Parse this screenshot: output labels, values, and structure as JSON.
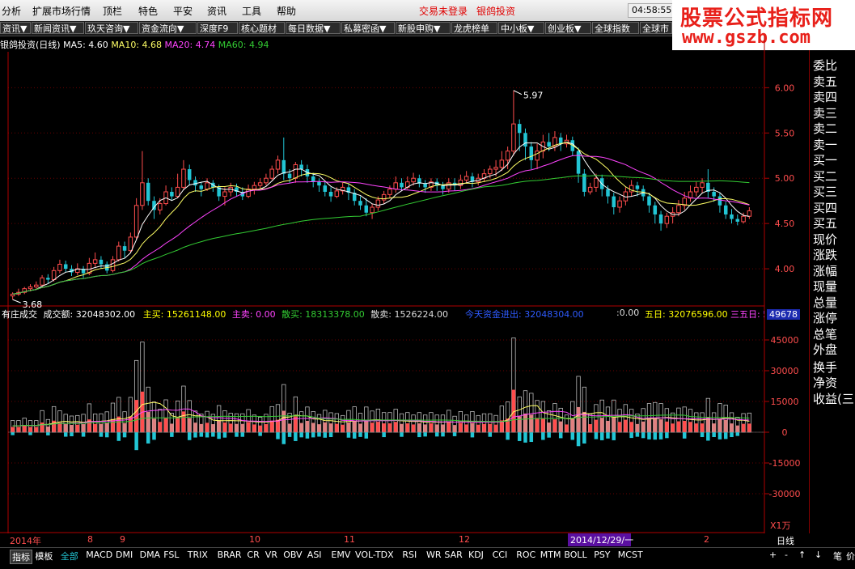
{
  "menu": {
    "items": [
      "分析",
      "扩展市场行情",
      "顶栏",
      "特色",
      "平安",
      "资讯",
      "工具",
      "帮助"
    ],
    "login_status": "交易未登录",
    "broker": "银鸽投资",
    "clock": "04:58:55"
  },
  "logo": {
    "line1": "股票公式指标网",
    "line2": "www.gszb.com"
  },
  "toolbar": {
    "items": [
      "资讯▼",
      "新闻资讯▼",
      "玖天咨询▼",
      "资金流向▼",
      "深度F9",
      "核心题材",
      "每日数据▼",
      "私募密函▼",
      "新股申购▼",
      "龙虎榜单",
      "中小板▼",
      "创业板▼",
      "全球指数",
      "全球市"
    ]
  },
  "main_legend": {
    "title": "银鸽投资(日线)",
    "ma5_label": "MA5: 4.60",
    "ma10_label": "MA10: 4.68",
    "ma20_label": "MA20: 4.74",
    "ma60_label": "MA60: 4.94"
  },
  "price_axis": [
    "6.00",
    "5.50",
    "5.00",
    "4.50",
    "4.00"
  ],
  "annotations": {
    "high": "5.97",
    "low": "3.68"
  },
  "sub_legend": {
    "name": "有庄成交",
    "turnover": "成交额: 32048302.00",
    "main_buy": "主买: 15261148.00",
    "main_sell": "主卖: 0.00",
    "retail_buy": "散买: 18313378.00",
    "retail_sell": "散卖: 1526224.00",
    "today_flow": "今天资金进出: 32048304.00",
    "tail": ":0.00",
    "five_day": "五日: 32076596.00",
    "three_five": "三五日: 5",
    "readout": "49678"
  },
  "volume_axis": [
    "45000",
    "30000",
    "15000",
    "0",
    "-15000",
    "-30000"
  ],
  "unit": "X1万",
  "date_axis": {
    "labels": [
      "2014年",
      "8",
      "9",
      "10",
      "11",
      "12",
      "1",
      "2"
    ],
    "cursor_date": "2014/12/29/一"
  },
  "period": "日线",
  "right_panel": {
    "items": [
      "委比",
      "卖五",
      "卖四",
      "卖三",
      "卖二",
      "卖一",
      "买一",
      "买二",
      "买三",
      "买四",
      "买五",
      "现价",
      "涨跌",
      "涨幅",
      "现量",
      "总量",
      "涨停",
      "总笔",
      "外盘",
      "换手",
      "净资",
      "收益(三)"
    ]
  },
  "bottom_tabs": {
    "items": [
      "指标",
      "模板",
      "全部",
      "MACD",
      "DMI",
      "DMA",
      "FSL",
      "TRIX",
      "BRAR",
      "CR",
      "VR",
      "OBV",
      "ASI",
      "EMV",
      "VOL-TDX",
      "RSI",
      "WR",
      "SAR",
      "KDJ",
      "CCI",
      "ROC",
      "MTM",
      "BOLL",
      "PSY",
      "MCST"
    ],
    "right_controls": [
      "+",
      "-",
      "↑",
      "↓",
      "笔",
      "价"
    ]
  },
  "colors": {
    "up": "#ff4d4d",
    "down": "#22c5d4",
    "ma5": "#ffffff",
    "ma10": "#ffff66",
    "ma20": "#ff44ff",
    "ma60": "#33cc33",
    "axis": "#b00000",
    "grid": "#6a0000"
  },
  "chart_data": {
    "type": "candlestick",
    "price_range": [
      3.5,
      6.2
    ],
    "candles": [
      [
        3.7,
        3.72,
        3.66,
        3.74
      ],
      [
        3.72,
        3.74,
        3.7,
        3.78
      ],
      [
        3.74,
        3.78,
        3.72,
        3.8
      ],
      [
        3.78,
        3.8,
        3.75,
        3.83
      ],
      [
        3.8,
        3.82,
        3.78,
        3.86
      ],
      [
        3.82,
        3.9,
        3.8,
        3.93
      ],
      [
        3.9,
        3.88,
        3.84,
        3.94
      ],
      [
        3.88,
        3.98,
        3.86,
        4.02
      ],
      [
        3.98,
        4.05,
        3.95,
        4.1
      ],
      [
        4.05,
        4.0,
        3.96,
        4.09
      ],
      [
        4.0,
        3.96,
        3.92,
        4.04
      ],
      [
        3.96,
        4.0,
        3.93,
        4.06
      ],
      [
        4.0,
        3.95,
        3.9,
        4.03
      ],
      [
        3.95,
        4.06,
        3.93,
        4.12
      ],
      [
        4.06,
        4.1,
        4.02,
        4.18
      ],
      [
        4.1,
        4.05,
        4.0,
        4.14
      ],
      [
        4.05,
        3.98,
        3.95,
        4.08
      ],
      [
        3.98,
        4.1,
        3.96,
        4.14
      ],
      [
        4.1,
        4.25,
        4.08,
        4.3
      ],
      [
        4.25,
        4.2,
        4.12,
        4.3
      ],
      [
        4.2,
        4.35,
        4.18,
        4.4
      ],
      [
        4.35,
        4.7,
        4.32,
        4.78
      ],
      [
        4.7,
        4.95,
        4.65,
        5.3
      ],
      [
        4.95,
        4.75,
        4.7,
        5.0
      ],
      [
        4.75,
        4.65,
        4.55,
        4.8
      ],
      [
        4.65,
        4.72,
        4.6,
        4.78
      ],
      [
        4.72,
        4.85,
        4.7,
        4.92
      ],
      [
        4.85,
        4.8,
        4.75,
        4.9
      ],
      [
        4.8,
        4.9,
        4.78,
        5.05
      ],
      [
        4.9,
        5.1,
        4.88,
        5.2
      ],
      [
        5.1,
        4.98,
        4.92,
        5.15
      ],
      [
        4.98,
        4.92,
        4.85,
        5.02
      ],
      [
        4.92,
        4.88,
        4.8,
        4.96
      ],
      [
        4.88,
        4.95,
        4.86,
        5.0
      ],
      [
        4.95,
        4.9,
        4.85,
        4.98
      ],
      [
        4.9,
        4.8,
        4.75,
        4.93
      ],
      [
        4.8,
        4.85,
        4.7,
        4.9
      ],
      [
        4.85,
        4.9,
        4.8,
        4.95
      ],
      [
        4.9,
        4.85,
        4.8,
        4.94
      ],
      [
        4.85,
        4.8,
        4.76,
        4.9
      ],
      [
        4.8,
        4.88,
        4.78,
        4.93
      ],
      [
        4.88,
        4.92,
        4.82,
        4.96
      ],
      [
        4.92,
        4.95,
        4.88,
        5.0
      ],
      [
        4.95,
        5.0,
        4.92,
        5.05
      ],
      [
        5.0,
        5.1,
        4.98,
        5.14
      ],
      [
        5.1,
        5.2,
        5.05,
        5.25
      ],
      [
        5.2,
        5.05,
        4.98,
        5.45
      ],
      [
        5.05,
        5.0,
        4.95,
        5.1
      ],
      [
        5.0,
        5.15,
        4.95,
        5.18
      ],
      [
        5.15,
        5.1,
        5.02,
        5.2
      ],
      [
        5.1,
        5.02,
        4.95,
        5.15
      ],
      [
        5.02,
        4.96,
        4.9,
        5.06
      ],
      [
        4.96,
        4.92,
        4.85,
        5.0
      ],
      [
        4.92,
        4.85,
        4.8,
        4.96
      ],
      [
        4.85,
        4.8,
        4.74,
        4.9
      ],
      [
        4.8,
        4.86,
        4.78,
        4.9
      ],
      [
        4.86,
        4.9,
        4.82,
        4.95
      ],
      [
        4.9,
        4.84,
        4.76,
        4.94
      ],
      [
        4.84,
        4.75,
        4.7,
        4.88
      ],
      [
        4.75,
        4.7,
        4.65,
        4.8
      ],
      [
        4.7,
        4.62,
        4.58,
        4.78
      ],
      [
        4.62,
        4.68,
        4.55,
        4.72
      ],
      [
        4.68,
        4.76,
        4.64,
        4.8
      ],
      [
        4.76,
        4.82,
        4.72,
        4.86
      ],
      [
        4.82,
        4.88,
        4.78,
        4.92
      ],
      [
        4.88,
        4.95,
        4.84,
        5.02
      ],
      [
        4.95,
        4.9,
        4.86,
        5.0
      ],
      [
        4.9,
        4.96,
        4.88,
        5.02
      ],
      [
        4.96,
        5.0,
        4.92,
        5.06
      ],
      [
        5.0,
        4.94,
        4.9,
        5.04
      ],
      [
        4.94,
        4.9,
        4.84,
        4.98
      ],
      [
        4.9,
        4.96,
        4.86,
        5.0
      ],
      [
        4.96,
        4.92,
        4.86,
        5.0
      ],
      [
        4.92,
        4.88,
        4.82,
        4.96
      ],
      [
        4.88,
        4.95,
        4.84,
        5.0
      ],
      [
        4.95,
        4.92,
        4.86,
        5.0
      ],
      [
        4.92,
        4.98,
        4.88,
        5.04
      ],
      [
        4.98,
        5.02,
        4.94,
        5.08
      ],
      [
        5.02,
        4.96,
        4.9,
        5.06
      ],
      [
        4.96,
        5.0,
        4.92,
        5.05
      ],
      [
        5.0,
        5.05,
        4.96,
        5.1
      ],
      [
        5.05,
        5.1,
        5.0,
        5.14
      ],
      [
        5.1,
        5.12,
        5.02,
        5.2
      ],
      [
        5.12,
        5.2,
        5.08,
        5.3
      ],
      [
        5.2,
        5.3,
        5.1,
        5.35
      ],
      [
        5.3,
        5.6,
        5.25,
        5.97
      ],
      [
        5.6,
        5.5,
        5.3,
        5.65
      ],
      [
        5.5,
        5.35,
        5.2,
        5.55
      ],
      [
        5.35,
        5.2,
        5.1,
        5.4
      ],
      [
        5.2,
        5.3,
        5.1,
        5.38
      ],
      [
        5.3,
        5.4,
        5.22,
        5.48
      ],
      [
        5.4,
        5.35,
        5.3,
        5.5
      ],
      [
        5.35,
        5.45,
        5.3,
        5.52
      ],
      [
        5.45,
        5.38,
        5.3,
        5.5
      ],
      [
        5.38,
        5.42,
        5.34,
        5.48
      ],
      [
        5.42,
        5.3,
        5.25,
        5.46
      ],
      [
        5.3,
        5.05,
        4.95,
        5.34
      ],
      [
        5.05,
        4.85,
        4.8,
        5.1
      ],
      [
        4.85,
        4.9,
        4.82,
        4.95
      ],
      [
        4.9,
        5.0,
        4.85,
        5.05
      ],
      [
        5.0,
        4.88,
        4.8,
        5.04
      ],
      [
        4.88,
        4.8,
        4.72,
        4.92
      ],
      [
        4.8,
        4.68,
        4.6,
        4.84
      ],
      [
        4.68,
        4.75,
        4.62,
        4.8
      ],
      [
        4.75,
        4.85,
        4.7,
        4.9
      ],
      [
        4.85,
        4.92,
        4.8,
        4.98
      ],
      [
        4.92,
        4.88,
        4.8,
        4.96
      ],
      [
        4.88,
        4.8,
        4.75,
        4.92
      ],
      [
        4.8,
        4.7,
        4.62,
        4.84
      ],
      [
        4.7,
        4.6,
        4.5,
        4.74
      ],
      [
        4.6,
        4.5,
        4.42,
        4.64
      ],
      [
        4.5,
        4.58,
        4.45,
        4.62
      ],
      [
        4.58,
        4.62,
        4.5,
        4.68
      ],
      [
        4.62,
        4.7,
        4.58,
        4.76
      ],
      [
        4.7,
        4.78,
        4.65,
        4.85
      ],
      [
        4.78,
        4.85,
        4.74,
        4.92
      ],
      [
        4.85,
        4.9,
        4.8,
        4.96
      ],
      [
        4.9,
        4.95,
        4.84,
        5.0
      ],
      [
        4.95,
        4.85,
        4.78,
        5.1
      ],
      [
        4.85,
        4.8,
        4.74,
        4.9
      ],
      [
        4.8,
        4.7,
        4.62,
        4.84
      ],
      [
        4.7,
        4.6,
        4.55,
        4.74
      ],
      [
        4.6,
        4.55,
        4.5,
        4.66
      ],
      [
        4.55,
        4.52,
        4.48,
        4.6
      ],
      [
        4.52,
        4.58,
        4.5,
        4.62
      ],
      [
        4.58,
        4.64,
        4.55,
        4.68
      ]
    ]
  }
}
